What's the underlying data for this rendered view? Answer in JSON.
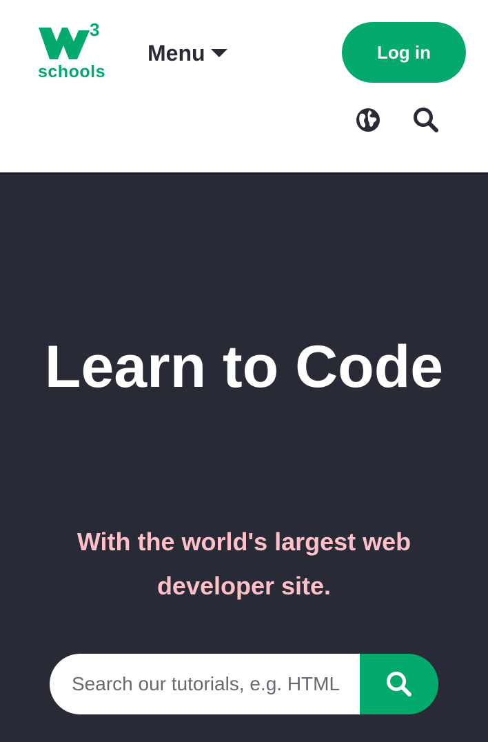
{
  "header": {
    "logo": {
      "superscript": "3",
      "wordmark": "schools"
    },
    "menu_label": "Menu",
    "login_label": "Log in",
    "icons": {
      "language": "globe-icon",
      "search": "search-icon"
    }
  },
  "hero": {
    "title": "Learn to Code",
    "subtitle": "With the world's largest web developer site.",
    "search": {
      "placeholder": "Search our tutorials, e.g. HTML",
      "value": "",
      "submit_icon": "search-icon"
    }
  },
  "colors": {
    "brand_green": "#04aa6d",
    "dark_background": "#282a35",
    "subtitle_pink": "#ffc0c7",
    "header_background": "#ffffff"
  }
}
